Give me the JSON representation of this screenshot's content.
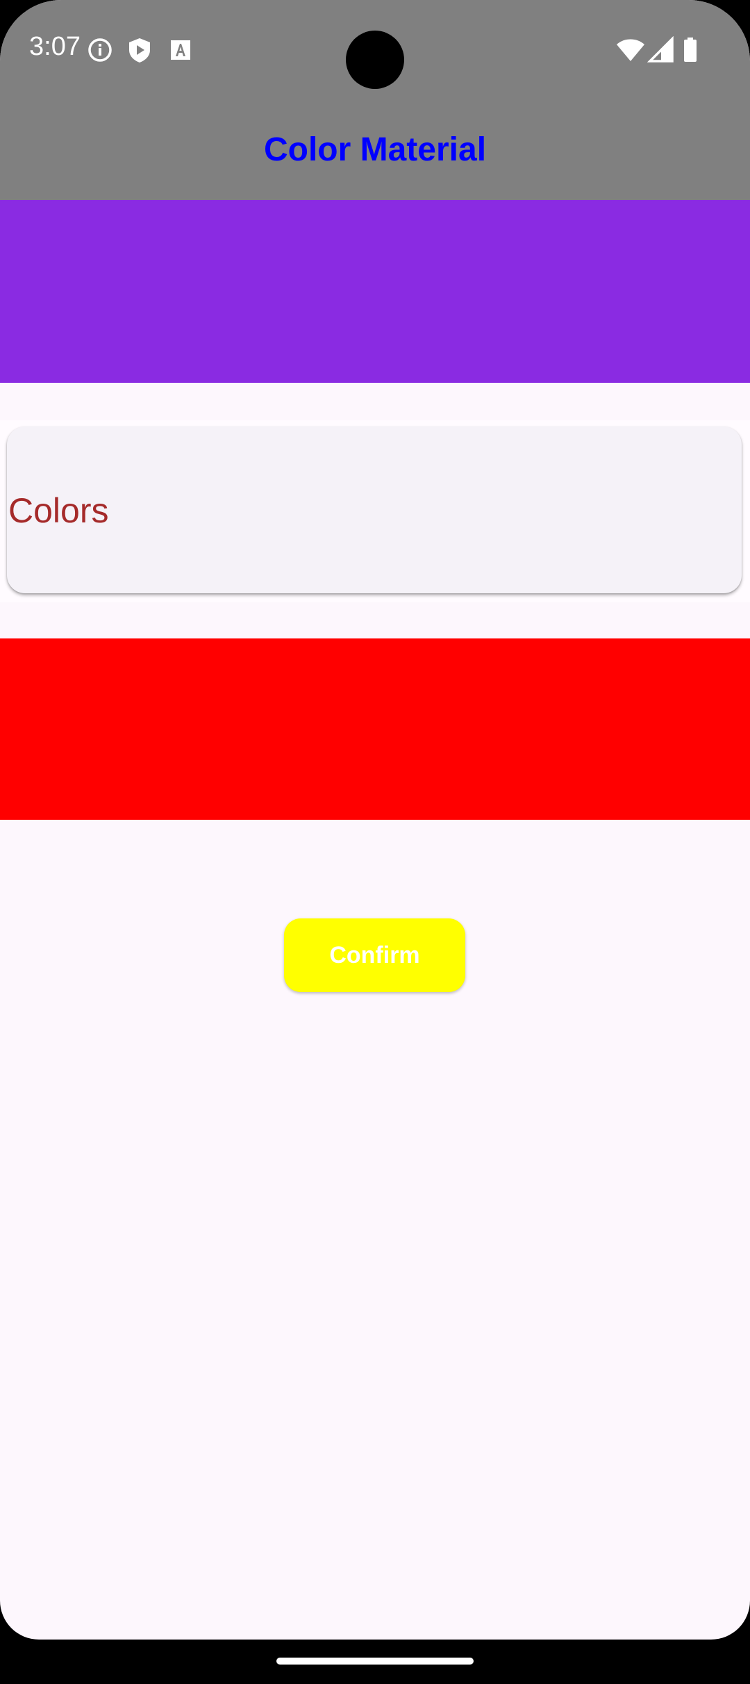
{
  "status_bar": {
    "time": "3:07",
    "left_icons": [
      "info-icon",
      "shield-play-icon",
      "font-icon"
    ],
    "right_icons": [
      "wifi-icon",
      "cellular-signal-icon",
      "battery-icon"
    ],
    "background_color": "#808080"
  },
  "app_bar": {
    "title": "Color Material",
    "title_color": "#0000ff",
    "background_color": "#808080"
  },
  "blocks": {
    "purple_color": "#8a2be2",
    "red_color": "#ff0000"
  },
  "card": {
    "label": "Colors",
    "label_color": "#a52a2a",
    "background_color": "#f5f2f8"
  },
  "confirm_button": {
    "label": "Confirm",
    "background_color": "#ffff00",
    "text_color": "#ffffff"
  },
  "screen": {
    "background_color": "#fdf7fd"
  }
}
